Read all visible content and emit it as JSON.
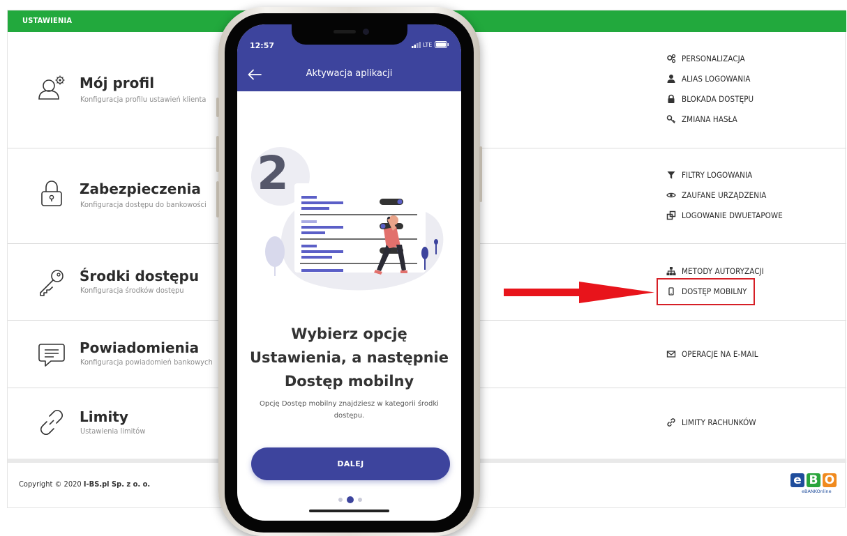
{
  "topbar": {
    "title": "USTAWIENIA"
  },
  "sections": [
    {
      "title": "Mój profil",
      "description": "Konfiguracja profilu ustawień klienta",
      "icon": "user-gear-icon",
      "links": [
        {
          "label": "PERSONALIZACJA",
          "icon": "gears-icon"
        },
        {
          "label": "ALIAS LOGOWANIA",
          "icon": "user-icon"
        },
        {
          "label": "BLOKADA DOSTĘPU",
          "icon": "lock-icon"
        },
        {
          "label": "ZMIANA HASŁA",
          "icon": "key-icon"
        }
      ]
    },
    {
      "title": "Zabezpieczenia",
      "description": "Konfiguracja dostępu do bankowości",
      "icon": "padlock-icon",
      "links": [
        {
          "label": "FILTRY LOGOWANIA",
          "icon": "filter-icon"
        },
        {
          "label": "ZAUFANE URZĄDZENIA",
          "icon": "eye-icon"
        },
        {
          "label": "LOGOWANIE DWUETAPOWE",
          "icon": "two-windows-icon"
        }
      ]
    },
    {
      "title": "Środki dostępu",
      "description": "Konfiguracja środków dostępu",
      "icon": "key-icon",
      "links": [
        {
          "label": "METODY AUTORYZACJI",
          "icon": "sitemap-icon"
        },
        {
          "label": "DOSTĘP MOBILNY",
          "icon": "mobile-icon"
        }
      ]
    },
    {
      "title": "Powiadomienia",
      "description": "Konfiguracja powiadomień bankowych",
      "icon": "message-icon",
      "links": [
        {
          "label": "OPERACJE NA E-MAIL",
          "icon": "envelope-icon"
        }
      ]
    },
    {
      "title": "Limity",
      "description": "Ustawienia limitów",
      "icon": "link-icon",
      "links": [
        {
          "label": "LIMITY RACHUNKÓW",
          "icon": "link-icon"
        }
      ]
    }
  ],
  "footer": {
    "copyright_prefix": "Copyright © 2020 ",
    "company": "I-BS.pl Sp. z o. o."
  },
  "logo": {
    "letters": [
      "e",
      "B",
      "O"
    ],
    "caption": "eBANKOnline"
  },
  "phone": {
    "status_time": "12:57",
    "network": "LTE",
    "app_title": "Aktywacja aplikacji",
    "step_number": "2",
    "heading_lines": [
      "Wybierz opcję",
      "Ustawienia, a następnie",
      "Dostęp mobilny"
    ],
    "subtext": "Opcję Dostęp mobilny znajdziesz w kategorii środki dostępu.",
    "button_label": "DALEJ",
    "page_index": 2,
    "page_count": 3
  },
  "colors": {
    "brand_green": "#22a93d",
    "app_indigo": "#3d449d",
    "highlight_red": "#d61f26"
  }
}
